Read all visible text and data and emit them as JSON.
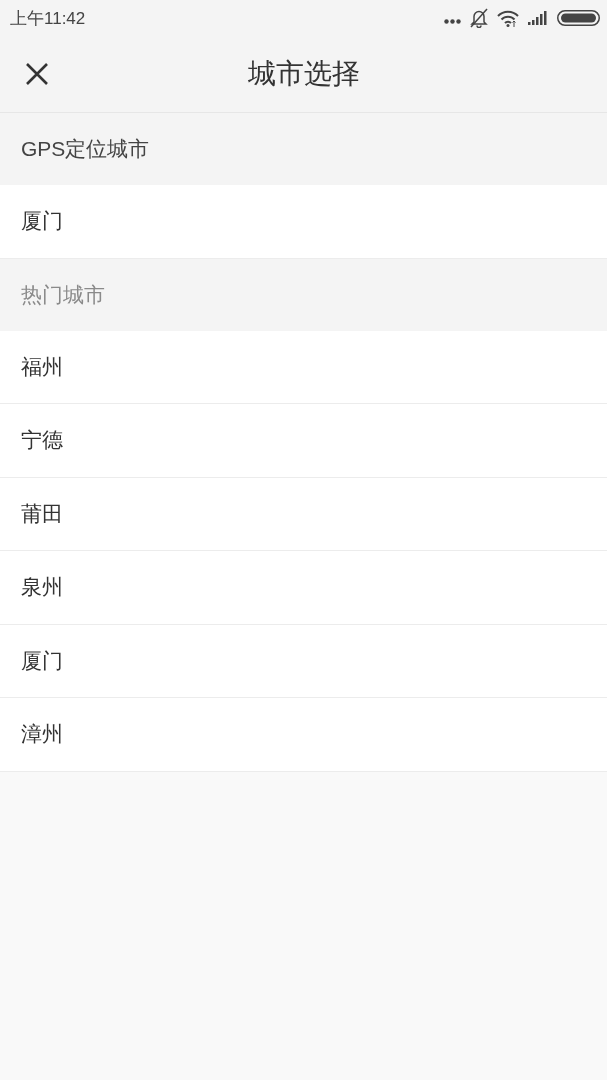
{
  "status_bar": {
    "time": "上午11:42"
  },
  "header": {
    "title": "城市选择"
  },
  "sections": [
    {
      "title": "GPS定位城市",
      "muted": false,
      "cities": [
        "厦门"
      ]
    },
    {
      "title": "热门城市",
      "muted": true,
      "cities": [
        "福州",
        "宁德",
        "莆田",
        "泉州",
        "厦门",
        "漳州"
      ]
    }
  ]
}
